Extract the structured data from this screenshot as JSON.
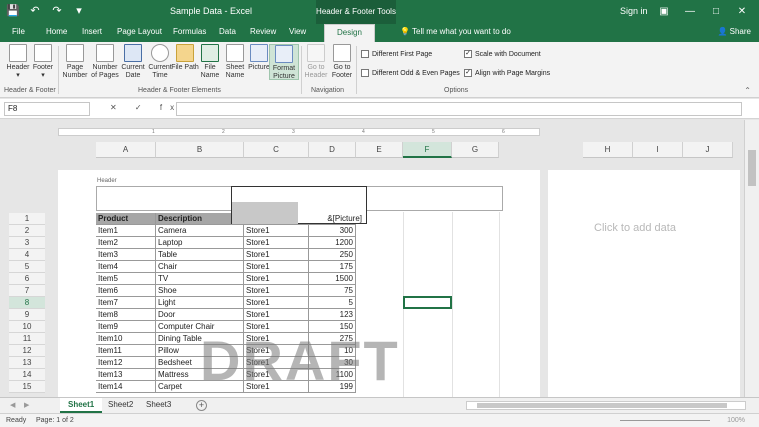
{
  "titlebar": {
    "doc_title": "Sample Data - Excel",
    "context_title": "Header & Footer Tools",
    "signin": "Sign in",
    "save_icon": "save-icon",
    "undo_icon": "undo-icon",
    "redo_icon": "redo-icon",
    "brand_color": "#217346"
  },
  "tabs": {
    "file": "File",
    "home": "Home",
    "insert": "Insert",
    "page_layout": "Page Layout",
    "formulas": "Formulas",
    "data": "Data",
    "review": "Review",
    "view": "View",
    "design": "Design",
    "tellme": "Tell me what you want to do",
    "share": "Share"
  },
  "ribbon": {
    "header": "Header",
    "footer": "Footer",
    "page_number": "Page Number",
    "number_of_pages": "Number of Pages",
    "current_date": "Current Date",
    "current_time": "Current Time",
    "file_path": "File Path",
    "file_name": "File Name",
    "sheet_name": "Sheet Name",
    "picture": "Picture",
    "format_picture": "Format Picture",
    "goto_header": "Go to Header",
    "goto_footer": "Go to Footer",
    "group_hf": "Header & Footer",
    "group_elements": "Header & Footer Elements",
    "group_navigation": "Navigation",
    "group_options": "Options",
    "opt_first_page": "Different First Page",
    "opt_odd_even": "Different Odd & Even Pages",
    "opt_scale": "Scale with Document",
    "opt_align": "Align with Page Margins",
    "check_mark": "✓"
  },
  "formula_bar": {
    "name_box": "F8",
    "fx_symbols": "✕ ✓ fx",
    "value": ""
  },
  "ruler": {
    "marks": [
      "1",
      "2",
      "3",
      "4",
      "5",
      "6",
      "7"
    ]
  },
  "columns": [
    "A",
    "B",
    "C",
    "D",
    "E",
    "F",
    "G"
  ],
  "columns_page2": [
    "H",
    "I",
    "J"
  ],
  "rows": [
    "1",
    "2",
    "3",
    "4",
    "5",
    "6",
    "7",
    "8",
    "9",
    "10",
    "11",
    "12",
    "13",
    "14",
    "15"
  ],
  "page": {
    "header_label": "Header",
    "picture_code": "&[Picture]",
    "watermark": "DRAFT",
    "add_data": "Click to add data"
  },
  "table": {
    "headers": [
      "Product",
      "Description",
      "",
      ""
    ],
    "rows": [
      [
        "Item1",
        "Camera",
        "Store1",
        "300"
      ],
      [
        "Item2",
        "Laptop",
        "Store1",
        "1200"
      ],
      [
        "Item3",
        "Table",
        "Store1",
        "250"
      ],
      [
        "Item4",
        "Chair",
        "Store1",
        "175"
      ],
      [
        "Item5",
        "TV",
        "Store1",
        "1500"
      ],
      [
        "Item6",
        "Shoe",
        "Store1",
        "75"
      ],
      [
        "Item7",
        "Light",
        "Store1",
        "5"
      ],
      [
        "Item8",
        "Door",
        "Store1",
        "123"
      ],
      [
        "Item9",
        "Computer Chair",
        "Store1",
        "150"
      ],
      [
        "Item10",
        "Dining Table",
        "Store1",
        "275"
      ],
      [
        "Item11",
        "Pillow",
        "Store1",
        "10"
      ],
      [
        "Item12",
        "Bedsheet",
        "Store1",
        "30"
      ],
      [
        "Item13",
        "Mattress",
        "Store1",
        "1100"
      ],
      [
        "Item14",
        "Carpet",
        "Store1",
        "199"
      ]
    ]
  },
  "sheet_tabs": [
    "Sheet1",
    "Sheet2",
    "Sheet3"
  ],
  "add_sheet": "+",
  "status": {
    "ready": "Ready",
    "page_info": "Page: 1 of 2",
    "zoom": "100%"
  }
}
